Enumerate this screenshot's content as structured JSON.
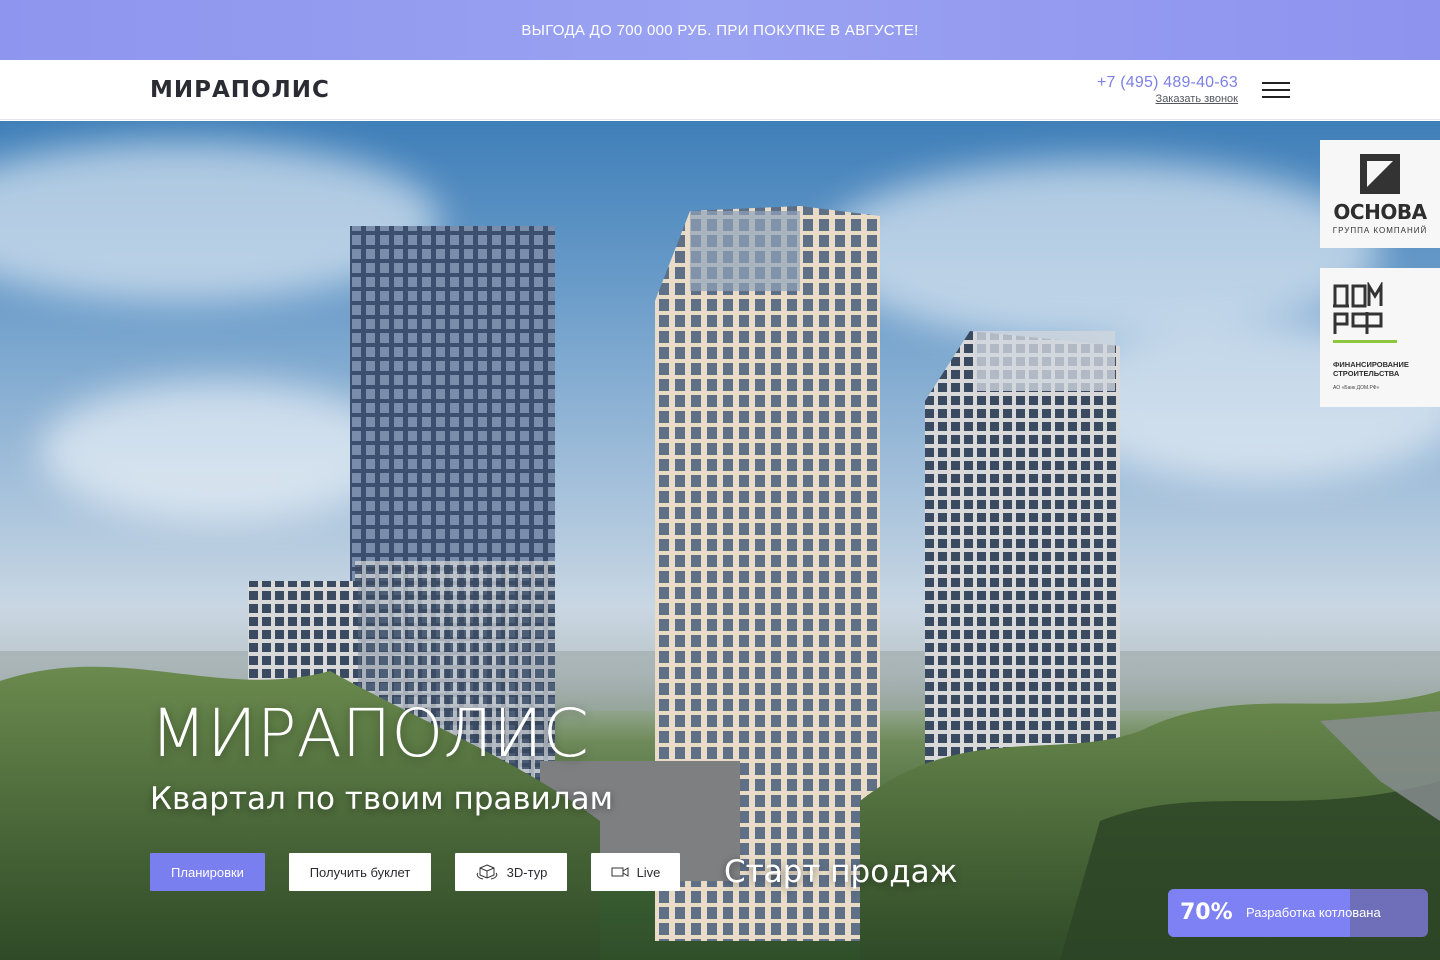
{
  "promo": {
    "text": "ВЫГОДА ДО 700 000 РУБ. ПРИ ПОКУПКЕ В АВГУСТЕ!"
  },
  "header": {
    "logo": "МИРАПОЛИС",
    "phone": "+7 (495) 489-40-63",
    "callback": "Заказать звонок",
    "menu_icon": "hamburger-icon"
  },
  "hero": {
    "title": "МИРАПОЛИС",
    "subtitle": "Квартал по твоим правилам",
    "buttons": {
      "plans": "Планировки",
      "booklet": "Получить буклет",
      "tour": "3D-тур",
      "live": "Live"
    },
    "button_icons": {
      "tour": "cube-360-icon",
      "live": "video-camera-icon"
    },
    "sales_start": "Старт продаж"
  },
  "partners": {
    "osnova": {
      "name": "ОСНОВА",
      "subtitle": "ГРУППА КОМПАНИЙ"
    },
    "domrf": {
      "line1": "ФИНАНСИРОВАНИЕ",
      "line2": "СТРОИТЕЛЬСТВА",
      "line3": "АО «Банк ДОМ.РФ»"
    }
  },
  "progress": {
    "value": 0.7,
    "percent_label": "70%",
    "label": "Разработка котлована"
  },
  "colors": {
    "accent": "#7a7ff0",
    "phone": "#7d80e6",
    "promo_bg": "#9aa2f2",
    "domrf_green": "#8dc63f"
  }
}
